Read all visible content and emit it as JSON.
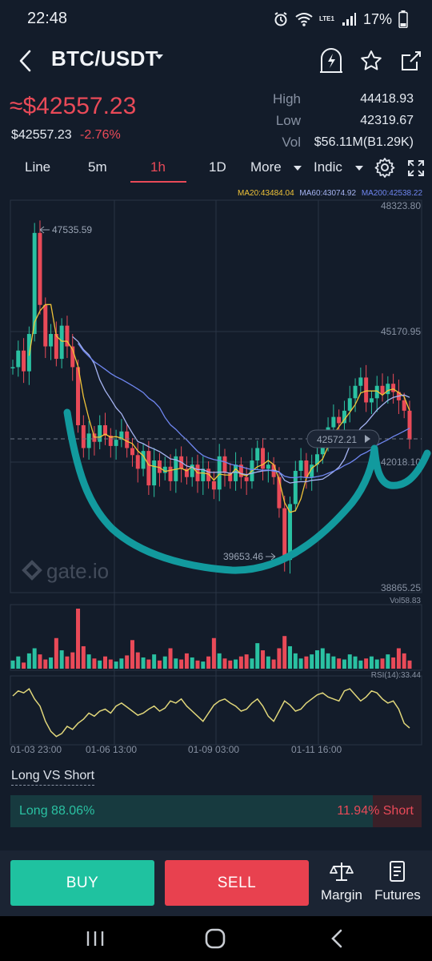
{
  "status_bar": {
    "time": "22:48",
    "battery": "17%",
    "network": "LTE1"
  },
  "header": {
    "pair": "BTC/USDT"
  },
  "ticker": {
    "approx_price": "≈$42557.23",
    "price": "$42557.23",
    "change": "-2.76%",
    "high_label": "High",
    "high": "44418.93",
    "low_label": "Low",
    "low": "42319.67",
    "vol_label": "Vol",
    "vol": "$56.11M(B1.29K)"
  },
  "intervals": {
    "tabs": [
      "Line",
      "5m",
      "1h",
      "1D"
    ],
    "active": "1h",
    "more": "More",
    "indic": "Indic"
  },
  "indicators": {
    "ma20": "MA20:43484.04",
    "ma60": "MA60:43074.92",
    "ma200": "MA200:42538.22"
  },
  "chart": {
    "price_axis": [
      "48323.80",
      "45170.95",
      "42018.10",
      "38865.25"
    ],
    "current_price_tag": "42572.21",
    "high_marker": "47535.59",
    "low_marker": "39653.46",
    "watermark": "gate.io",
    "vol_label": "Vol58.83",
    "rsi_label": "RSI(14):33.44",
    "time_labels": [
      "01-03 23:00",
      "01-06 13:00",
      "01-09 03:00",
      "01-11 16:00"
    ]
  },
  "chart_data": {
    "type": "candlestick",
    "ylim": [
      38865.25,
      48323.8
    ],
    "ma": [
      {
        "name": "MA20",
        "value": 43484.04,
        "color": "#f0c338"
      },
      {
        "name": "MA60",
        "value": 43074.92,
        "color": "#a6b4f2"
      },
      {
        "name": "MA200",
        "value": 42538.22,
        "color": "#6f86f0"
      }
    ],
    "close_path": [
      44300,
      44700,
      44200,
      45100,
      47535.59,
      45800,
      44800,
      45100,
      44500,
      45300,
      44800,
      44300,
      42900,
      42350,
      42700,
      42500,
      42900,
      42650,
      42400,
      42550,
      42750,
      42350,
      42180,
      41850,
      42280,
      41450,
      42050,
      41750,
      41900,
      41550,
      42150,
      41850,
      41650,
      41950,
      41550,
      41850,
      41550,
      41350,
      42150,
      41750,
      41550,
      41950,
      41650,
      41550,
      42050,
      42350,
      41850,
      41950,
      41650,
      40900,
      39653.46,
      41000,
      41800,
      42050,
      41650,
      41950,
      42200,
      42550,
      42850,
      43100,
      42950,
      43250,
      43550,
      43850,
      44050,
      43450,
      43550,
      43850,
      43650,
      43900,
      43700,
      43500,
      43250,
      42557.23
    ],
    "volume": [
      8,
      12,
      6,
      15,
      20,
      14,
      9,
      11,
      30,
      18,
      12,
      16,
      58.83,
      22,
      14,
      10,
      8,
      12,
      9,
      7,
      10,
      13,
      28,
      16,
      11,
      9,
      14,
      8,
      12,
      20,
      10,
      9,
      15,
      11,
      8,
      7,
      12,
      30,
      15,
      10,
      8,
      9,
      12,
      14,
      10,
      25,
      18,
      12,
      9,
      20,
      32,
      22,
      15,
      10,
      12,
      14,
      18,
      20,
      15,
      12,
      10,
      9,
      14,
      12,
      8,
      10,
      12,
      9,
      10,
      14,
      11,
      20,
      15,
      8
    ],
    "rsi": [
      65,
      70,
      68,
      72,
      62,
      55,
      40,
      30,
      25,
      28,
      35,
      32,
      38,
      42,
      48,
      45,
      50,
      52,
      48,
      55,
      58,
      54,
      50,
      46,
      48,
      52,
      55,
      50,
      53,
      60,
      58,
      62,
      55,
      50,
      45,
      40,
      48,
      56,
      60,
      62,
      58,
      55,
      50,
      52,
      58,
      62,
      55,
      45,
      40,
      50,
      60,
      56,
      50,
      52,
      58,
      62,
      66,
      68,
      64,
      62,
      60,
      70,
      72,
      66,
      60,
      64,
      70,
      68,
      62,
      58,
      60,
      52,
      38,
      33.44
    ]
  },
  "long_short": {
    "title": "Long VS Short",
    "long_label": "Long 88.06%",
    "short_label": "11.94% Short",
    "long_pct": 88.06
  },
  "actions": {
    "buy": "BUY",
    "sell": "SELL",
    "margin": "Margin",
    "futures": "Futures"
  },
  "colors": {
    "up": "#2ac1a2",
    "down": "#e94a58",
    "accent": "#e94a58",
    "bg": "#131c2a"
  }
}
